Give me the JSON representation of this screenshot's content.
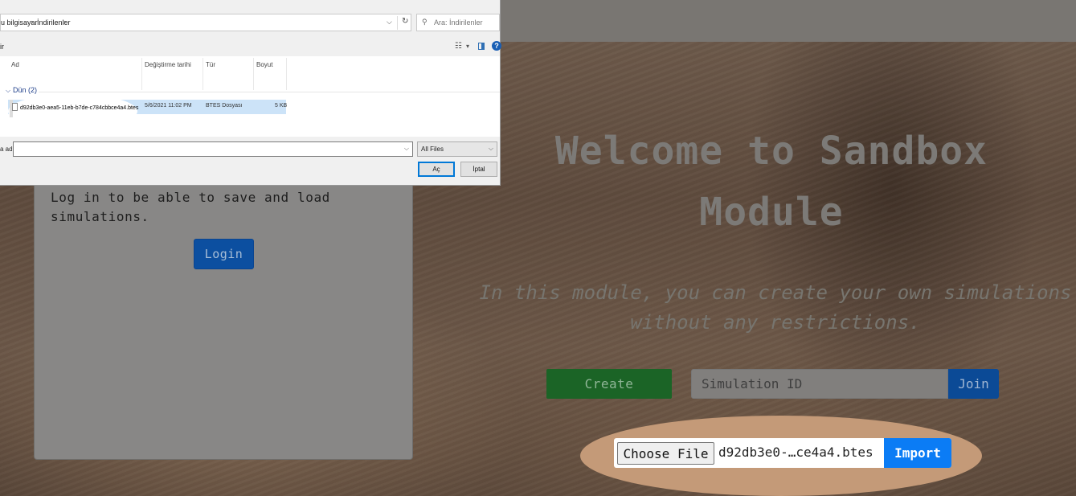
{
  "file_dialog": {
    "breadcrumbs": [
      "u bilgisayar",
      "İndirilenler"
    ],
    "search_placeholder": "Ara: İndirilenler",
    "toolbar_left": "ir",
    "columns": [
      "Ad",
      "Değiştirme tarihi",
      "Tür",
      "Boyut"
    ],
    "group_label": "Dün (2)",
    "files": [
      {
        "name": "d92db3e0-aea5-11eb-b7de-c784cbbce4a4.btes",
        "date": "5/6/2021 11:02 PM",
        "type": "BTES Dosyası",
        "size": "5 KB"
      }
    ],
    "filename_label": "a adı:",
    "filetype_value": "All Files",
    "open_label": "Aç",
    "cancel_label": "İptal"
  },
  "login_panel": {
    "text": "Log in to be able to save and load simulations.",
    "login_label": "Login"
  },
  "hero": {
    "title": "Welcome to Sandbox Module",
    "subtitle_line1": "In this module, you can create your own simulations",
    "subtitle_line2": "without any restrictions."
  },
  "actions": {
    "create_label": "Create",
    "simulation_id_placeholder": "Simulation ID",
    "join_label": "Join",
    "choose_file_label": "Choose File",
    "chosen_file_name": "d92db3e0-…ce4a4.btes",
    "import_label": "Import"
  },
  "colors": {
    "navbar": "#797672",
    "create_button": "#1b6426",
    "join_button": "#0b4a96",
    "import_button": "#0b7cf5",
    "highlight": "#c49a78"
  }
}
